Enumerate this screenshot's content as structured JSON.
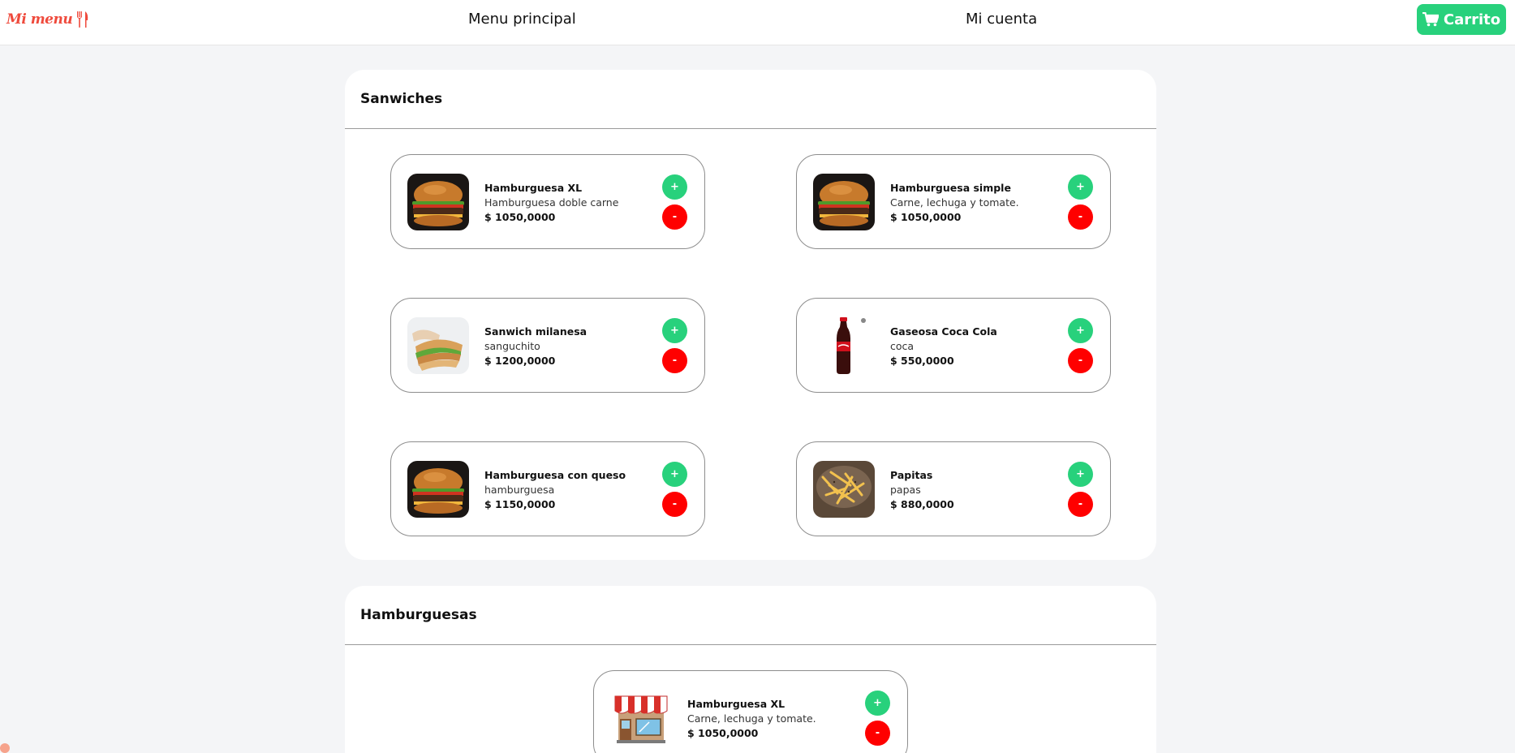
{
  "brand": {
    "name": "Mi menu",
    "icon": "fork-knife-icon",
    "color": "#ef4a3c"
  },
  "nav": {
    "menu_label": "Menu principal",
    "account_label": "Mi cuenta",
    "cart_label": "Carrito",
    "cart_icon": "shopping-cart-icon",
    "cart_color": "#28d17c"
  },
  "colors": {
    "add": "#28d17c",
    "remove": "#ff0000"
  },
  "sections": [
    {
      "title": "Sanwiches",
      "products": [
        {
          "name": "Hamburguesa XL",
          "description": "Hamburguesa doble carne",
          "price": "$ 1050,0000",
          "image": "burger-image",
          "add_label": "+",
          "remove_label": "-"
        },
        {
          "name": "Hamburguesa simple",
          "description": "Carne, lechuga y tomate.",
          "price": "$ 1050,0000",
          "image": "burger-image",
          "add_label": "+",
          "remove_label": "-"
        },
        {
          "name": "Sanwich milanesa",
          "description": "sanguchito",
          "price": "$ 1200,0000",
          "image": "sandwich-image",
          "add_label": "+",
          "remove_label": "-"
        },
        {
          "name": "Gaseosa Coca Cola",
          "description": "coca",
          "price": "$ 550,0000",
          "image": "soda-bottle-image",
          "add_label": "+",
          "remove_label": "-"
        },
        {
          "name": "Hamburguesa con queso",
          "description": "hamburguesa",
          "price": "$ 1150,0000",
          "image": "burger-image",
          "add_label": "+",
          "remove_label": "-"
        },
        {
          "name": "Papitas",
          "description": "papas",
          "price": "$ 880,0000",
          "image": "fries-image",
          "add_label": "+",
          "remove_label": "-"
        }
      ]
    },
    {
      "title": "Hamburguesas",
      "products": [
        {
          "name": "Hamburguesa XL",
          "description": "Carne, lechuga y tomate.",
          "price": "$ 1050,0000",
          "image": "store-image",
          "add_label": "+",
          "remove_label": "-"
        }
      ]
    }
  ]
}
